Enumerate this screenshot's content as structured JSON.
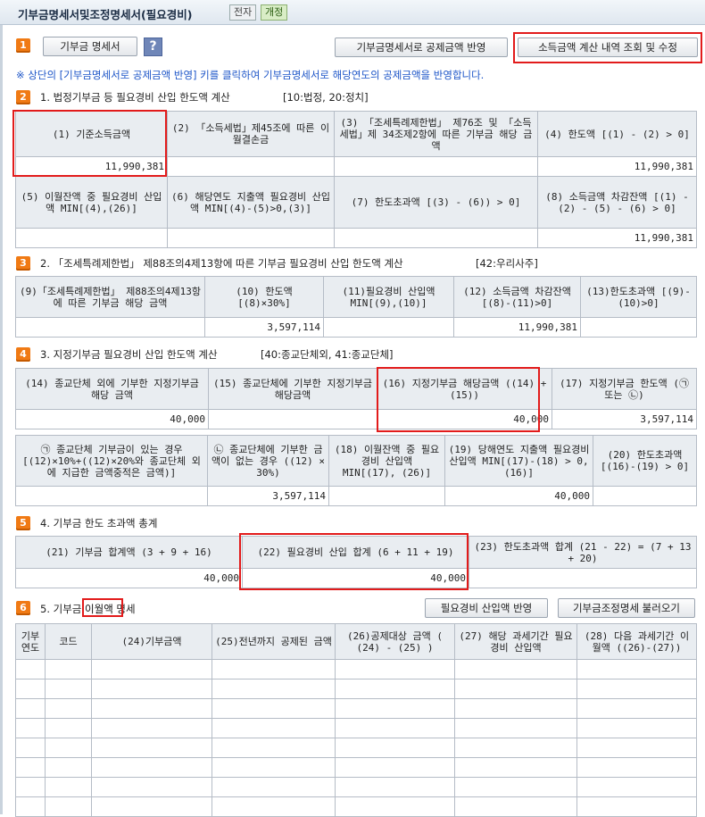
{
  "window": {
    "title": "기부금명세서및조정명세서(필요경비)",
    "tag1": "전자",
    "tag2": "개정"
  },
  "toolbar": {
    "section_number": "1",
    "tab_label": "기부금 명세서",
    "help_label": "?",
    "reflect_button": "기부금명세서로 공제금액 반영",
    "inquiry_button": "소득금액 계산 내역 조회 및 수정"
  },
  "notice": "※ 상단의 [기부금명세서로 공제금액 반영] 키를 클릭하여 기부금명세서로 해당연도의 공제금액을 반영합니다.",
  "section1": {
    "number": "2",
    "title": "1. 법정기부금 등 필요경비 산입 한도액 계산",
    "note": "[10:법정, 20:정치]",
    "row1_headers": [
      "(1) 기준소득금액",
      "(2) 「소득세법」제45조에 따른 이월결손금",
      "(3) 「조세특례제한법」 제76조 및 「소득세법」제 34조제2항에 따른 기부금 해당 금액",
      "(4) 한도액 [(1) - (2) > 0]"
    ],
    "row1_values": [
      "11,990,381",
      "",
      "",
      "11,990,381"
    ],
    "row2_headers": [
      "(5) 이월잔액 중 필요경비 산입액 MIN[(4),(26)]",
      "(6) 해당연도 지출액 필요경비 산입액 MIN[(4)-(5)>0,(3)]",
      "(7) 한도초과액 [(3) - (6)) > 0]",
      "(8) 소득금액 차감잔액 [(1) - (2) - (5) - (6) > 0]"
    ],
    "row2_values": [
      "",
      "",
      "",
      "11,990,381"
    ]
  },
  "section2": {
    "number": "3",
    "title": "2. 「조세특례제한법」 제88조의4제13항에 따른 기부금 필요경비 산입 한도액 계산",
    "note": "[42:우리사주]",
    "headers": [
      "(9)「조세특례제한법」 제88조의4제13항에 따른 기부금 해당 금액",
      "(10) 한도액 [(8)×30%]",
      "(11)필요경비 산입액 MIN[(9),(10)]",
      "(12) 소득금액 차감잔액 [(8)-(11)>0]",
      "(13)한도초과액 [(9)-(10)>0]"
    ],
    "values": [
      "",
      "3,597,114",
      "",
      "11,990,381",
      ""
    ]
  },
  "section3": {
    "number": "4",
    "title": "3. 지정기부금 필요경비 산입 한도액 계산",
    "note": "[40:종교단체외, 41:종교단체]",
    "row1_headers": [
      "(14) 종교단체 외에 기부한 지정기부금 해당 금액",
      "(15) 종교단체에 기부한 지정기부금 해당금액",
      "(16) 지정기부금 해당금액 ((14) + (15))",
      "(17) 지정기부금 한도액 (㉠ 또는 ㉡)"
    ],
    "row1_values": [
      "40,000",
      "",
      "40,000",
      "3,597,114"
    ],
    "row2_headers": [
      "㉠ 종교단체 기부금이 있는 경우 [(12)×10%+((12)×20%와 종교단체 외에 지급한 금액중적은 금액)]",
      "㉡ 종교단체에 기부한 금액이 없는 경우 ((12) × 30%)",
      "(18) 이월잔액 중 필요경비 산입액 MIN[(17), (26)]",
      "(19) 당해연도 지출액 필요경비 산입액 MIN[(17)-(18) > 0,(16)]",
      "(20) 한도초과액 [(16)-(19) > 0]"
    ],
    "row2_values": [
      "",
      "3,597,114",
      "",
      "40,000",
      ""
    ]
  },
  "section4": {
    "number": "5",
    "title": "4. 기부금 한도 초과액 총계",
    "headers": [
      "(21) 기부금 합계액 (3 + 9 + 16)",
      "(22) 필요경비 산입 합계 (6 + 11 + 19)",
      "(23) 한도초과액 합계 (21 - 22) = (7 + 13 + 20)"
    ],
    "values": [
      "40,000",
      "40,000",
      ""
    ]
  },
  "section5": {
    "number": "6",
    "title_prefix": "5. 기부금 ",
    "title_highlight": "이월액",
    "title_suffix": " 명세",
    "button1": "필요경비 산입액 반영",
    "button2": "기부금조정명세 불러오기",
    "headers": [
      "기부 연도",
      "코드",
      "(24)기부금액",
      "(25)전년까지 공제된 금액",
      "(26)공제대상 금액 ( (24) - (25) )",
      "(27) 해당 과세기간 필요경비 산입액",
      "(28) 다음 과세기간 이월액 ((26)-(27))"
    ]
  }
}
